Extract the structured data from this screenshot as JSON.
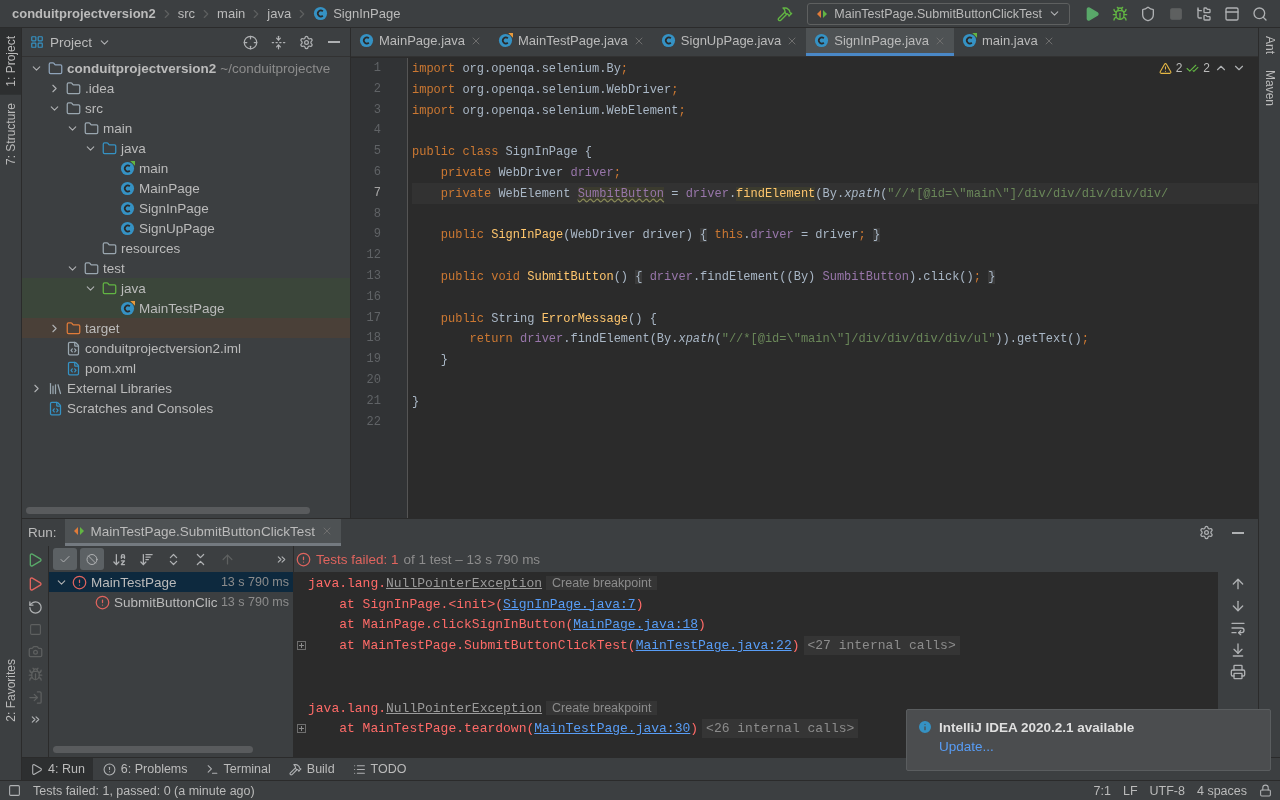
{
  "breadcrumbs": [
    {
      "text": "conduitprojectversion2",
      "kind": "project"
    },
    {
      "text": "src",
      "kind": "folder"
    },
    {
      "text": "main",
      "kind": "folder"
    },
    {
      "text": "java",
      "kind": "folder"
    },
    {
      "text": "SignInPage",
      "kind": "class"
    }
  ],
  "run_config": "MainTestPage.SubmitButtonClickTest",
  "left_stripe": [
    {
      "label": "1: Project",
      "selected": true
    },
    {
      "label": "7: Structure",
      "selected": false
    }
  ],
  "left_stripe_bottom": [
    {
      "label": "2: Favorites",
      "selected": false
    }
  ],
  "right_stripe": [
    {
      "label": "Ant"
    },
    {
      "label": "Maven"
    }
  ],
  "project": {
    "title": "Project",
    "tree": [
      {
        "label": "conduitprojectversion2",
        "hint": "~/conduitprojectve",
        "kind": "module",
        "expanded": true,
        "children": [
          {
            "label": ".idea",
            "kind": "folder",
            "expanded": false
          },
          {
            "label": "src",
            "kind": "folder",
            "expanded": true,
            "children": [
              {
                "label": "main",
                "kind": "folder",
                "expanded": true,
                "children": [
                  {
                    "label": "java",
                    "kind": "source",
                    "expanded": true,
                    "children": [
                      {
                        "label": "main",
                        "kind": "main-class"
                      },
                      {
                        "label": "MainPage",
                        "kind": "class"
                      },
                      {
                        "label": "SignInPage",
                        "kind": "class"
                      },
                      {
                        "label": "SignUpPage",
                        "kind": "class"
                      }
                    ]
                  },
                  {
                    "label": "resources",
                    "kind": "resources"
                  }
                ]
              },
              {
                "label": "test",
                "kind": "folder",
                "expanded": true,
                "children": [
                  {
                    "label": "java",
                    "kind": "test-source",
                    "expanded": true,
                    "children": [
                      {
                        "label": "MainTestPage",
                        "kind": "test-class"
                      }
                    ]
                  }
                ]
              }
            ]
          },
          {
            "label": "target",
            "kind": "excluded",
            "expanded": false
          },
          {
            "label": "conduitprojectversion2.iml",
            "kind": "iml"
          },
          {
            "label": "pom.xml",
            "kind": "pom"
          }
        ]
      },
      {
        "label": "External Libraries",
        "kind": "libraries",
        "expanded": false
      },
      {
        "label": "Scratches and Consoles",
        "kind": "scratches"
      }
    ]
  },
  "tabs": [
    {
      "label": "MainPage.java",
      "kind": "class",
      "selected": false
    },
    {
      "label": "MainTestPage.java",
      "kind": "test-class",
      "selected": false
    },
    {
      "label": "SignUpPage.java",
      "kind": "class",
      "selected": false
    },
    {
      "label": "SignInPage.java",
      "kind": "class",
      "selected": true
    },
    {
      "label": "main.java",
      "kind": "main-class",
      "selected": false
    }
  ],
  "inspections": {
    "warnings": "2",
    "weak_warnings": "2"
  },
  "code": [
    {
      "number": "1",
      "current": false,
      "tokens": [
        {
          "kind": "kw",
          "text": "import"
        },
        {
          "kind": "plain",
          "text": " org.openqa.selenium.By"
        },
        {
          "kind": "kw",
          "text": ";"
        }
      ]
    },
    {
      "number": "2",
      "current": false,
      "tokens": [
        {
          "kind": "kw",
          "text": "import"
        },
        {
          "kind": "plain",
          "text": " org.openqa.selenium.WebDriver"
        },
        {
          "kind": "kw",
          "text": ";"
        }
      ]
    },
    {
      "number": "3",
      "current": false,
      "tokens": [
        {
          "kind": "kw",
          "text": "import"
        },
        {
          "kind": "plain",
          "text": " org.openqa.selenium.WebElement"
        },
        {
          "kind": "kw",
          "text": ";"
        }
      ]
    },
    {
      "number": "4",
      "current": false
    },
    {
      "number": "5",
      "current": false,
      "tokens": [
        {
          "kind": "kw",
          "text": "public class"
        },
        {
          "kind": "plain",
          "text": " SignInPage {"
        }
      ]
    },
    {
      "number": "6",
      "current": false,
      "tokens": [
        {
          "kind": "kw",
          "text": "    private"
        },
        {
          "kind": "plain",
          "text": " WebDriver "
        },
        {
          "kind": "field",
          "text": "driver"
        },
        {
          "kind": "kw",
          "text": ";"
        }
      ]
    },
    {
      "number": "7",
      "current": true,
      "tokens": [
        {
          "kind": "kw",
          "text": "    private"
        },
        {
          "kind": "plain",
          "text": " WebElement "
        },
        {
          "kind": "unused",
          "text": "SumbitButton"
        },
        {
          "kind": "plain",
          "text": " = "
        },
        {
          "kind": "field",
          "text": "driver"
        },
        {
          "kind": "plain",
          "text": "."
        },
        {
          "kind": "method-hl",
          "text": "findElement"
        },
        {
          "kind": "plain",
          "text": "(By."
        },
        {
          "kind": "italic",
          "text": "xpath"
        },
        {
          "kind": "plain",
          "text": "("
        },
        {
          "kind": "string",
          "text": "\"//*[@id=\\\"main\\\"]/div/div/div/div/div/"
        }
      ]
    },
    {
      "number": "8",
      "current": false
    },
    {
      "number": "9",
      "current": false,
      "tokens": [
        {
          "kind": "kw",
          "text": "    public"
        },
        {
          "kind": "method",
          "text": " SignInPage"
        },
        {
          "kind": "plain",
          "text": "(WebDriver driver) "
        },
        {
          "kind": "folded",
          "text": "{"
        },
        {
          "kind": "kw",
          "text": " this"
        },
        {
          "kind": "plain",
          "text": "."
        },
        {
          "kind": "field",
          "text": "driver"
        },
        {
          "kind": "plain",
          "text": " = driver"
        },
        {
          "kind": "kw",
          "text": "; "
        },
        {
          "kind": "folded",
          "text": "}"
        }
      ]
    },
    {
      "number": "12",
      "current": false
    },
    {
      "number": "13",
      "current": false,
      "tokens": [
        {
          "kind": "kw",
          "text": "    public void"
        },
        {
          "kind": "method",
          "text": " SubmitButton"
        },
        {
          "kind": "plain",
          "text": "() "
        },
        {
          "kind": "folded",
          "text": "{"
        },
        {
          "kind": "field",
          "text": " driver"
        },
        {
          "kind": "plain",
          "text": ".findElement((By) "
        },
        {
          "kind": "field",
          "text": "SumbitButton"
        },
        {
          "kind": "plain",
          "text": ").click()"
        },
        {
          "kind": "kw",
          "text": "; "
        },
        {
          "kind": "folded",
          "text": "}"
        }
      ]
    },
    {
      "number": "16",
      "current": false
    },
    {
      "number": "17",
      "current": false,
      "tokens": [
        {
          "kind": "kw",
          "text": "    public"
        },
        {
          "kind": "plain",
          "text": " String "
        },
        {
          "kind": "method",
          "text": "ErrorMessage"
        },
        {
          "kind": "plain",
          "text": "() {"
        }
      ]
    },
    {
      "number": "18",
      "current": false,
      "tokens": [
        {
          "kind": "kw",
          "text": "        return"
        },
        {
          "kind": "field",
          "text": " driver"
        },
        {
          "kind": "plain",
          "text": ".findElement(By."
        },
        {
          "kind": "italic",
          "text": "xpath"
        },
        {
          "kind": "plain",
          "text": "("
        },
        {
          "kind": "string",
          "text": "\"//*[@id=\\\"main\\\"]/div/div/div/div/ul\""
        },
        {
          "kind": "plain",
          "text": ")).getText()"
        },
        {
          "kind": "kw",
          "text": ";"
        }
      ]
    },
    {
      "number": "19",
      "current": false,
      "tokens": [
        {
          "kind": "plain",
          "text": "    }"
        }
      ]
    },
    {
      "number": "20",
      "current": false
    },
    {
      "number": "21",
      "current": false,
      "tokens": [
        {
          "kind": "plain",
          "text": "}"
        }
      ]
    },
    {
      "number": "22",
      "current": false
    }
  ],
  "run": {
    "label": "Run:",
    "tab": "MainTestPage.SubmitButtonClickTest",
    "summary_failed": "Tests failed: 1",
    "summary_rest": "of 1 test – 13 s 790 ms",
    "tests": [
      {
        "name": "MainTestPage",
        "time": "13 s 790 ms",
        "selected": true,
        "expanded": true,
        "children": [
          {
            "name": "SubmitButtonClic",
            "time": "13 s 790 ms",
            "selected": false
          }
        ]
      }
    ],
    "console": [
      {
        "kind": "text",
        "foldable": false,
        "tokens": [
          {
            "kind": "error",
            "text": "java.lang."
          },
          {
            "kind": "error-link",
            "text": "NullPointerException"
          },
          {
            "kind": "hint",
            "text": "Create breakpoint"
          }
        ]
      },
      {
        "kind": "text",
        "foldable": false,
        "tokens": [
          {
            "kind": "error",
            "text": "    at SignInPage.<init>("
          },
          {
            "kind": "link",
            "text": "SignInPage.java:7"
          },
          {
            "kind": "error",
            "text": ")"
          }
        ]
      },
      {
        "kind": "text",
        "foldable": false,
        "tokens": [
          {
            "kind": "error",
            "text": "    at MainPage.clickSignInButton("
          },
          {
            "kind": "link",
            "text": "MainPage.java:18"
          },
          {
            "kind": "error",
            "text": ")"
          }
        ]
      },
      {
        "kind": "text",
        "foldable": true,
        "tokens": [
          {
            "kind": "error",
            "text": "    at MainTestPage.SubmitButtonClickTest("
          },
          {
            "kind": "link",
            "text": "MainTestPage.java:22"
          },
          {
            "kind": "error",
            "text": ")"
          },
          {
            "kind": "collapsed",
            "text": "<27 internal calls>"
          }
        ]
      },
      {
        "kind": "blank"
      },
      {
        "kind": "blank"
      },
      {
        "kind": "text",
        "foldable": false,
        "tokens": [
          {
            "kind": "error",
            "text": "java.lang."
          },
          {
            "kind": "error-link",
            "text": "NullPointerException"
          },
          {
            "kind": "hint",
            "text": "Create breakpoint"
          }
        ]
      },
      {
        "kind": "text",
        "foldable": true,
        "tokens": [
          {
            "kind": "error",
            "text": "    at MainTestPage.teardown("
          },
          {
            "kind": "link",
            "text": "MainTestPage.java:30"
          },
          {
            "kind": "error",
            "text": ")"
          },
          {
            "kind": "collapsed",
            "text": "<26 internal calls>"
          }
        ]
      }
    ]
  },
  "tool_tabs": [
    {
      "label": "4: Run",
      "kind": "run",
      "selected": true
    },
    {
      "label": "6: Problems",
      "kind": "problems",
      "selected": false
    },
    {
      "label": "Terminal",
      "kind": "terminal",
      "selected": false
    },
    {
      "label": "Build",
      "kind": "build",
      "selected": false
    },
    {
      "label": "TODO",
      "kind": "todo",
      "selected": false
    }
  ],
  "status": {
    "message": "Tests failed: 1, passed: 0 (a minute ago)",
    "items": [
      "7:1",
      "LF",
      "UTF-8",
      "4 spaces"
    ]
  },
  "notification": {
    "title": "IntelliJ IDEA 2020.2.1 available",
    "action": "Update..."
  }
}
